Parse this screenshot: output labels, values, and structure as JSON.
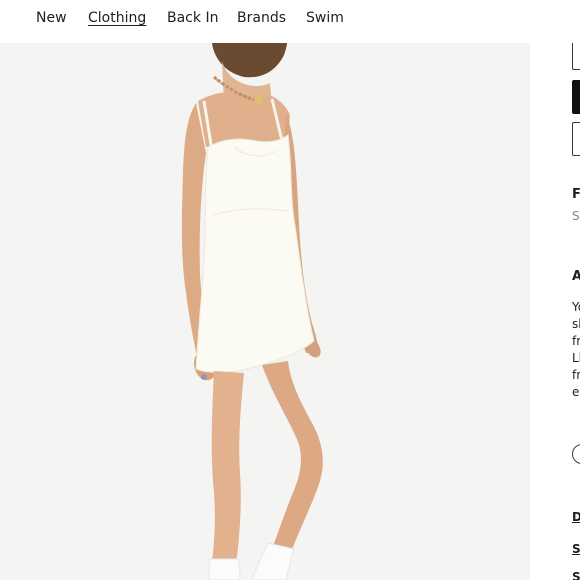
{
  "nav": {
    "items": [
      {
        "label": "New",
        "active": false
      },
      {
        "label": "Clothing",
        "active": true
      },
      {
        "label": "Back In",
        "active": false
      },
      {
        "label": "Brands",
        "active": false
      },
      {
        "label": "Swim",
        "active": false
      }
    ]
  },
  "product_image": {
    "dress_color": "#fbfaf3",
    "background": "#f4f4f3"
  },
  "side_panel": {
    "fit_heading": "Fi",
    "fit_value": "S",
    "about_heading": "A",
    "description_lines": [
      "Yo",
      "sl",
      "fr",
      "Ll",
      "fr",
      "er"
    ],
    "links": [
      "D",
      "Sl",
      "S"
    ]
  }
}
